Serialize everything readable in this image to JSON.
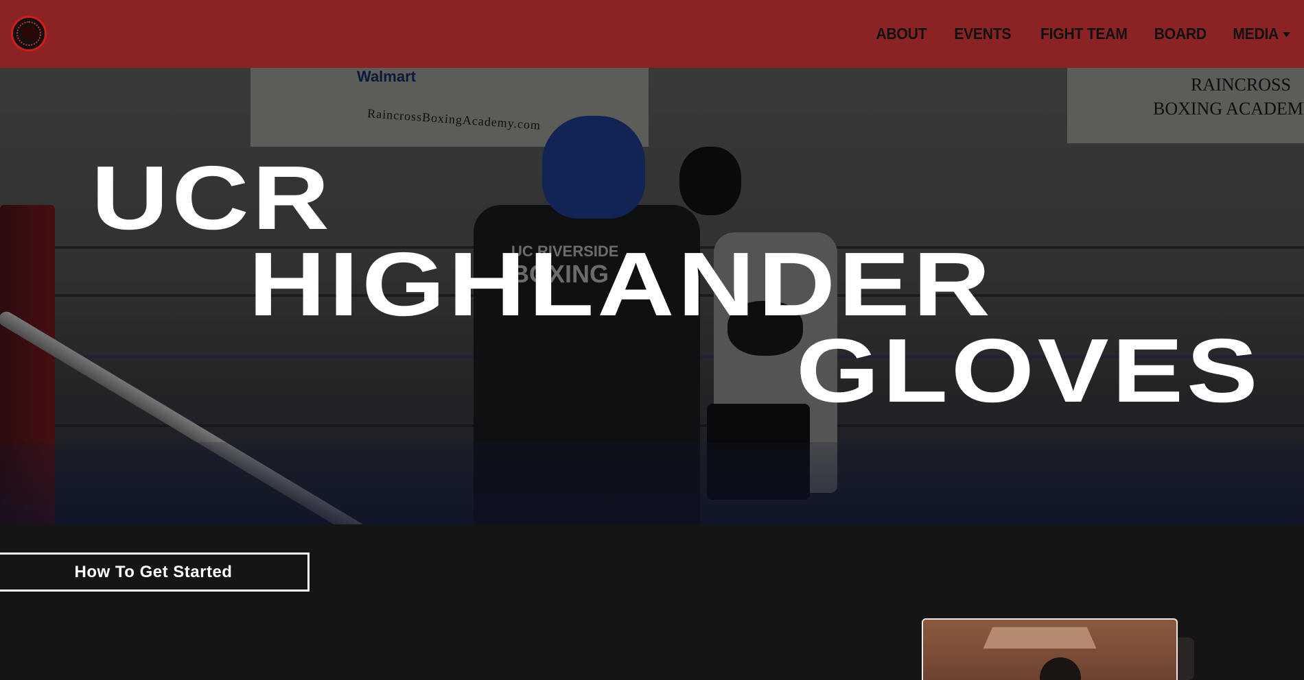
{
  "nav": {
    "logo_alt": "UCR Highlander Gloves logo",
    "links": [
      "ABOUT",
      "EVENTS",
      "FIGHT TEAM",
      "BOARD",
      "MEDIA"
    ]
  },
  "hero": {
    "words": [
      "UCR",
      "HIGHLANDER",
      "GLOVES"
    ],
    "banner_left": {
      "brand": "Walmart",
      "url": "RaincrossBoxingAcademy.com"
    },
    "banner_right": {
      "line1": "RAINCROSS",
      "line2": "BOXING ACADEMY"
    },
    "shirt_text": [
      "UC RIVERSIDE",
      "BOXING"
    ]
  },
  "cta": {
    "label": "How To Get Started"
  },
  "colors": {
    "navbar": "#8b2324",
    "page_bg": "#151515",
    "text_white": "#ffffff"
  }
}
